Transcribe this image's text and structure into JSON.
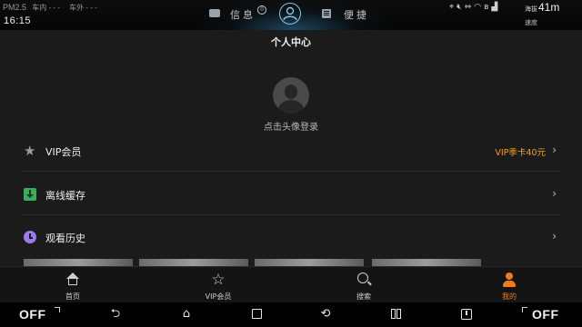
{
  "statusbar": {
    "pm_label": "PM2.5",
    "inside_label": "车内",
    "inside_value": "- - -",
    "outside_label": "车外",
    "outside_value": "- - -",
    "clock": "16:15",
    "messages_label": "信息",
    "messages_badge": "0",
    "shortcut_label": "便捷",
    "altitude_label": "海拔",
    "altitude_value": "41m",
    "speed_label": "速度",
    "glow_color": "#3c96c8"
  },
  "page": {
    "title": "个人中心",
    "login_tip": "点击头像登录"
  },
  "menu": [
    {
      "icon": "star-icon",
      "label": "VIP会员",
      "extra": "VIP季卡40元"
    },
    {
      "icon": "download-icon",
      "label": "离线缓存",
      "extra": ""
    },
    {
      "icon": "clock-icon",
      "label": "观看历史",
      "extra": ""
    }
  ],
  "bottom_nav": [
    {
      "icon": "home-icon",
      "label": "首页",
      "active": false
    },
    {
      "icon": "vip-icon",
      "label": "VIP会员",
      "active": false
    },
    {
      "icon": "search-icon",
      "label": "搜索",
      "active": false
    },
    {
      "icon": "user-icon",
      "label": "我的",
      "active": true
    }
  ],
  "system_bar": {
    "left_toggle": "OFF",
    "right_toggle": "OFF",
    "buttons": [
      "back-icon",
      "home-icon",
      "recents-icon",
      "rotate-icon",
      "split-screen-icon",
      "power-icon"
    ]
  },
  "colors": {
    "accent": "#f07b1a",
    "promo": "#f0a020",
    "download": "#3cab5a",
    "history": "#9b7be8",
    "background": "#1b1b1b"
  }
}
